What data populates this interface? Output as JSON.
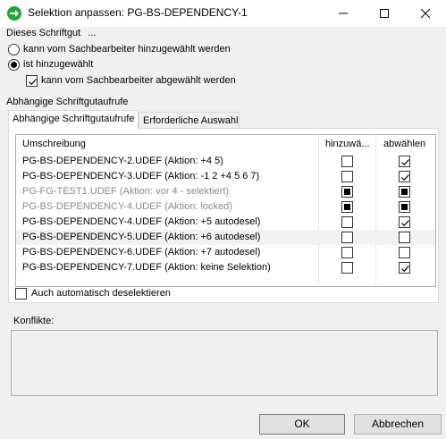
{
  "window": {
    "title": "Selektion anpassen: PG-BS-DEPENDENCY-1",
    "minimize_icon": "minimize-icon",
    "maximize_icon": "maximize-icon",
    "close_icon": "close-icon",
    "title_icon": "green-arrow-icon"
  },
  "schriftgut": {
    "group_label": "Dieses Schriftgut",
    "group_label_suffix": "...",
    "radio_options": [
      {
        "label": "kann vom Sachbearbeiter hinzugewählt werden",
        "selected": false
      },
      {
        "label": "ist hinzugewählt",
        "selected": true
      }
    ],
    "deselect_checkbox": {
      "label": "kann vom Sachbearbeiter abgewählt werden",
      "checked": true
    }
  },
  "abhaengige": {
    "group_label": "Abhängige Schriftgutaufrufe",
    "tabs": [
      {
        "label": "Abhängige Schriftgutaufrufe",
        "active": true
      },
      {
        "label": "Erforderliche Auswahl",
        "active": false
      }
    ],
    "columns": [
      "Umschreibung",
      "hinzuwä...",
      "abwählen"
    ],
    "rows": [
      {
        "text": "PG-BS-DEPENDENCY-2.UDEF (Aktion: +4 5)",
        "disabled": false,
        "add": "unchecked",
        "remove": "checked",
        "selected": false
      },
      {
        "text": "PG-BS-DEPENDENCY-3.UDEF (Aktion: -1 2  +4 5 6 7)",
        "disabled": false,
        "add": "unchecked",
        "remove": "checked",
        "selected": false
      },
      {
        "text": "PG-FG-TEST1.UDEF (Aktion: vor 4 - selektiert)",
        "disabled": true,
        "add": "indeterminate",
        "remove": "indeterminate",
        "selected": false
      },
      {
        "text": "PG-BS-DEPENDENCY-4.UDEF (Aktion: locked)",
        "disabled": true,
        "add": "indeterminate",
        "remove": "indeterminate",
        "selected": false
      },
      {
        "text": "PG-BS-DEPENDENCY-4.UDEF (Aktion: +5 autodesel)",
        "disabled": false,
        "add": "unchecked",
        "remove": "checked",
        "selected": false
      },
      {
        "text": "PG-BS-DEPENDENCY-5.UDEF (Aktion: +6 autodesel)",
        "disabled": false,
        "add": "unchecked",
        "remove": "unchecked",
        "selected": true
      },
      {
        "text": "PG-BS-DEPENDENCY-6.UDEF (Aktion: +7 autodesel)",
        "disabled": false,
        "add": "unchecked",
        "remove": "unchecked",
        "selected": false
      },
      {
        "text": "PG-BS-DEPENDENCY-7.UDEF (Aktion: keine Selektion)",
        "disabled": false,
        "add": "unchecked",
        "remove": "checked",
        "selected": false
      }
    ],
    "auto_deselect": {
      "label": "Auch automatisch deselektieren",
      "checked": false
    }
  },
  "konflikte": {
    "label": "Konflikte:"
  },
  "buttons": {
    "ok": "OK",
    "cancel": "Abbrechen"
  },
  "colors": {
    "title_icon": "#1fa33a",
    "disabled_text": "#8a8a8a",
    "selected_row": "#f2f2f2"
  }
}
